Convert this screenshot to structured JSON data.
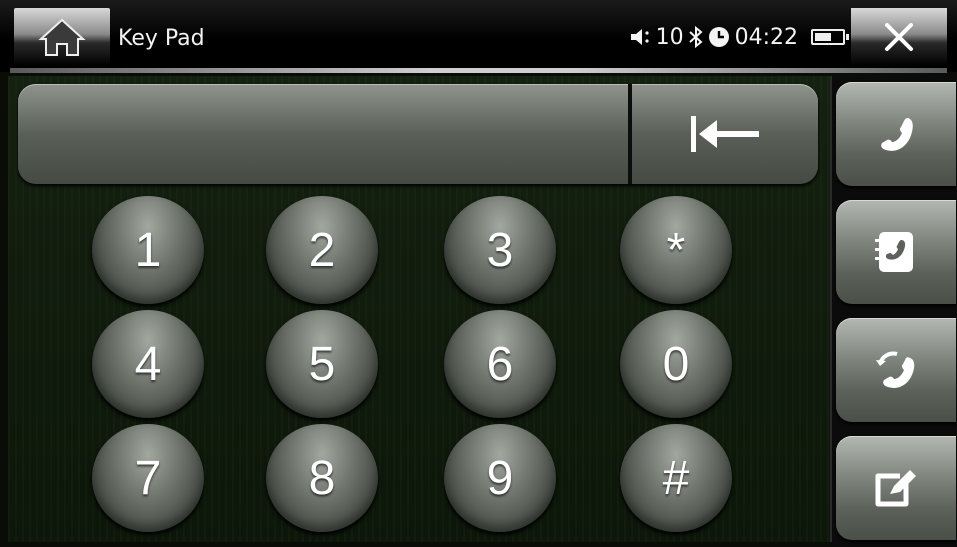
{
  "header": {
    "title": "Key Pad",
    "volume_level": "10",
    "clock": "04:22"
  },
  "dialer": {
    "display_value": "",
    "keys": [
      "1",
      "2",
      "3",
      "*",
      "4",
      "5",
      "6",
      "0",
      "7",
      "8",
      "9",
      "#"
    ]
  },
  "sidebar": {
    "tabs": [
      {
        "icon": "phone-handset-icon"
      },
      {
        "icon": "phonebook-icon"
      },
      {
        "icon": "call-history-icon"
      },
      {
        "icon": "sms-compose-icon"
      }
    ]
  },
  "colors": {
    "key_face": "#6f746d",
    "background": "#0c1709",
    "text": "#ffffff"
  }
}
